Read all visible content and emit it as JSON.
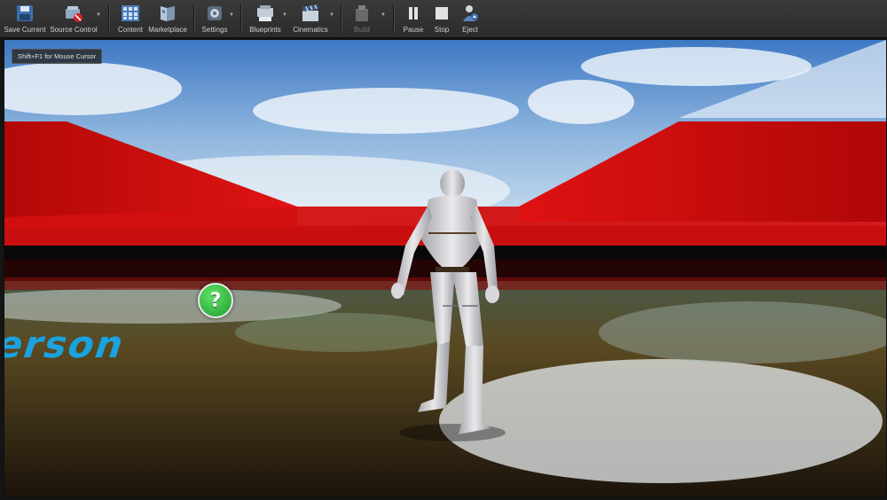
{
  "toolbar": {
    "save_current": "Save Current",
    "source_control": "Source Control",
    "content": "Content",
    "marketplace": "Marketplace",
    "settings": "Settings",
    "blueprints": "Blueprints",
    "cinematics": "Cinematics",
    "build": "Build",
    "pause": "Pause",
    "stop": "Stop",
    "eject": "Eject"
  },
  "viewport": {
    "hint": "Shift+F1 for Mouse Cursor",
    "floor_text": "rd Person",
    "pickup_glyph": "?"
  },
  "colors": {
    "wall_red": "#d81010",
    "floor_text_blue": "#1aa3e0",
    "pickup_green": "#22a82e"
  }
}
